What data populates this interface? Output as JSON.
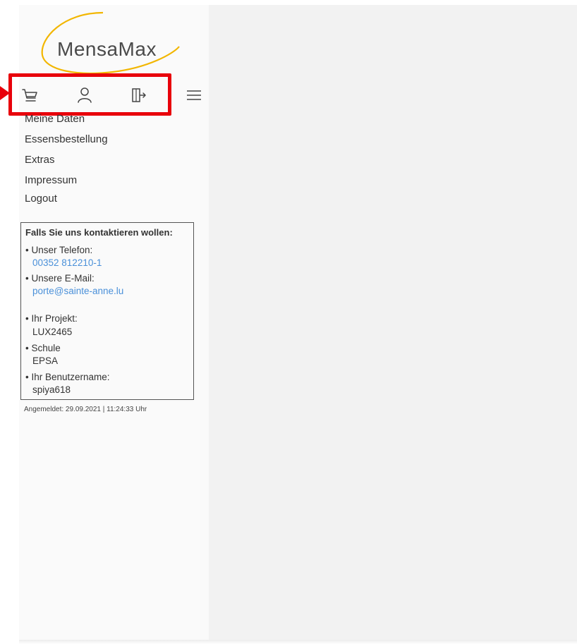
{
  "logo": {
    "text": "MensaMax"
  },
  "toolbar": {
    "icons": [
      "shopping-cart-icon",
      "user-icon",
      "logout-icon",
      "hamburger-menu-icon"
    ]
  },
  "colors": {
    "highlight": "#e8000b",
    "link": "#4a90d9",
    "logo_swoosh": "#f2b600"
  },
  "menu": {
    "items": [
      {
        "label": "Meine Daten"
      },
      {
        "label": "Essensbestellung"
      },
      {
        "label": "Extras"
      },
      {
        "label": "Impressum"
      },
      {
        "label": "Logout"
      }
    ]
  },
  "contact": {
    "title": "Falls Sie uns kontaktieren wollen:",
    "phone_label": "• Unser Telefon:",
    "phone": "00352 812210-1",
    "email_label": "• Unsere E-Mail:",
    "email": "porte@sainte-anne.lu",
    "project_label": "• Ihr Projekt:",
    "project": "LUX2465",
    "school_label": "• Schule",
    "school": "EPSA",
    "username_label": "• Ihr Benutzername:",
    "username": "spiya618"
  },
  "session": {
    "logged_in": "Angemeldet: 29.09.2021 | 11:24:33 Uhr"
  }
}
